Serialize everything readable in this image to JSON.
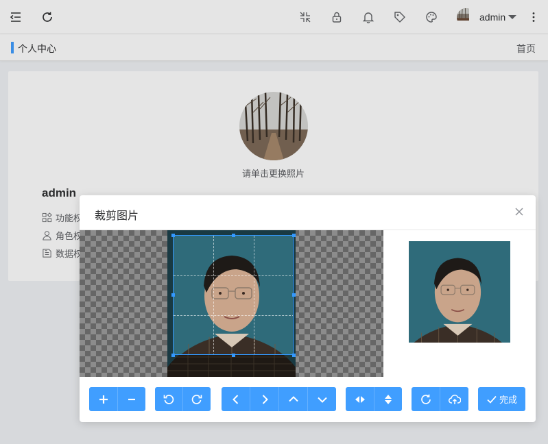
{
  "header": {
    "user_name": "admin",
    "icons": [
      "fold-menu-icon",
      "refresh-icon",
      "fullscreen-exit-icon",
      "lock-icon",
      "bell-icon",
      "tag-icon",
      "palette-icon",
      "more-vertical-icon"
    ]
  },
  "breadcrumb": {
    "title": "个人中心",
    "home": "首页"
  },
  "profile": {
    "change_photo_tip": "请单击更换照片",
    "name": "admin",
    "permissions": [
      {
        "label": "功能权限",
        "icon": "function-permission-icon"
      },
      {
        "label": "角色权限",
        "icon": "role-user-icon"
      },
      {
        "label": "数据权限",
        "icon": "data-permission-icon"
      }
    ]
  },
  "dialog": {
    "title": "裁剪图片",
    "done_label": "完成",
    "toolbar_groups": [
      [
        "zoom-in-icon",
        "zoom-out-icon"
      ],
      [
        "rotate-left-icon",
        "rotate-right-icon"
      ],
      [
        "move-left-icon",
        "move-right-icon",
        "move-up-icon",
        "move-down-icon"
      ],
      [
        "flip-horizontal-icon",
        "flip-vertical-icon"
      ],
      [
        "reset-icon",
        "upload-icon"
      ]
    ]
  },
  "colors": {
    "primary": "#409eff",
    "crop_border": "#3399ff",
    "photo_background": "#2f6b7a"
  }
}
